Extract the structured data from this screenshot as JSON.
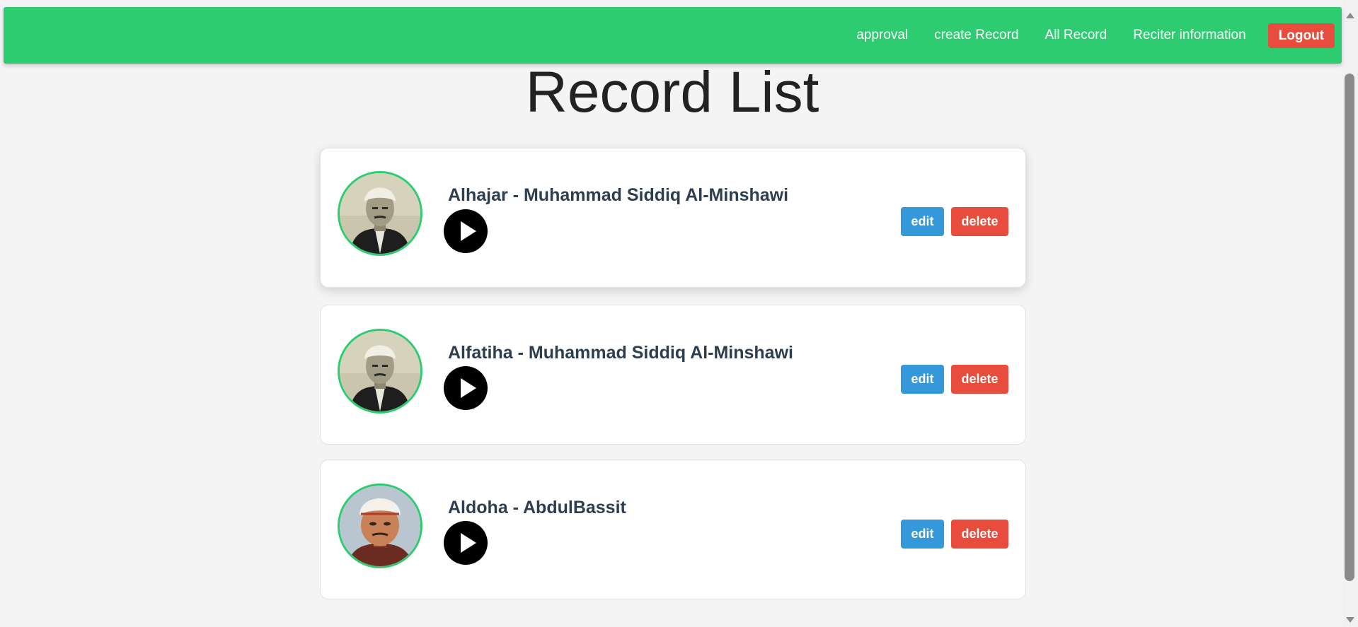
{
  "nav": {
    "links": [
      "approval",
      "create Record",
      "All Record",
      "Reciter information"
    ],
    "logout_label": "Logout",
    "bg_color": "#2ecc71",
    "logout_color": "#e74c3c"
  },
  "page": {
    "title": "Record List"
  },
  "records": [
    {
      "title": "Alhajar - Muhammad Siddiq Al-Minshawi",
      "avatar_icon": "reciter-minshawi-photo",
      "edit_label": "edit",
      "delete_label": "delete"
    },
    {
      "title": "Alfatiha - Muhammad Siddiq Al-Minshawi",
      "avatar_icon": "reciter-minshawi-photo",
      "edit_label": "edit",
      "delete_label": "delete"
    },
    {
      "title": "Aldoha - AbdulBassit",
      "avatar_icon": "reciter-abdulbassit-photo",
      "edit_label": "edit",
      "delete_label": "delete"
    }
  ],
  "colors": {
    "edit": "#3498db",
    "delete": "#e74c3c",
    "avatar_border": "#2ecc71",
    "title_text": "#2c3e50"
  }
}
